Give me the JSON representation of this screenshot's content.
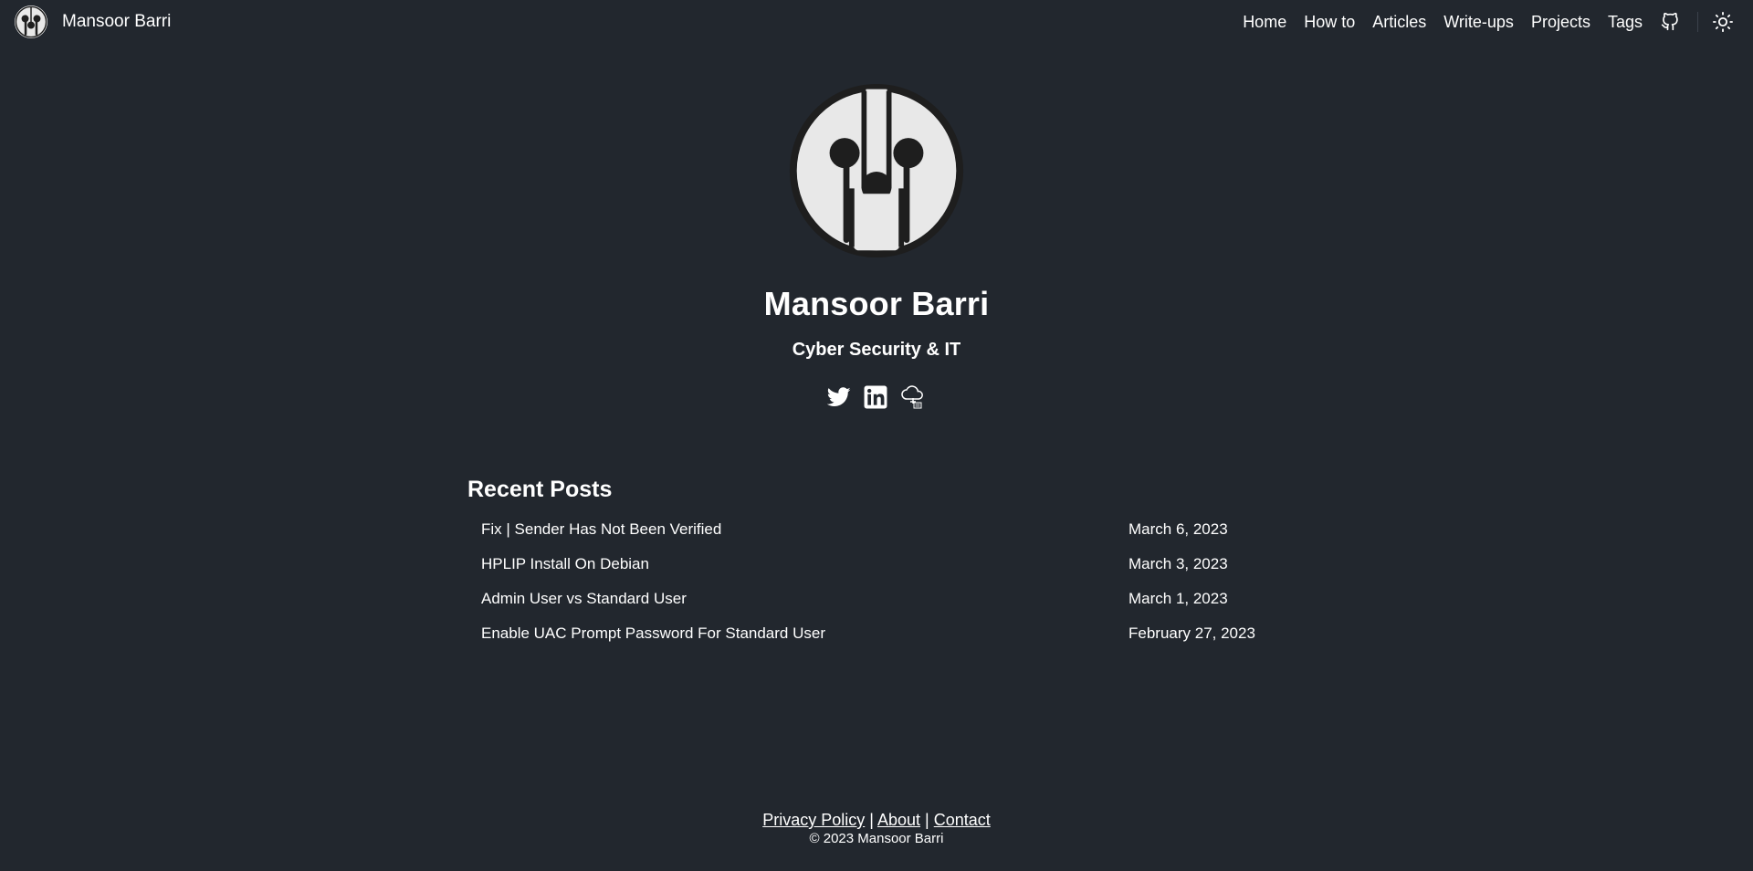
{
  "site": {
    "brand_name": "Mansoor Barri",
    "brand_logo_icon": "circuit-logo-icon"
  },
  "nav": {
    "items": [
      "Home",
      "How to",
      "Articles",
      "Write-ups",
      "Projects",
      "Tags"
    ],
    "github_icon": "github-icon",
    "theme_icon": "sun-icon"
  },
  "profile": {
    "avatar_icon": "circuit-logo-icon",
    "name": "Mansoor Barri",
    "subtitle": "Cyber Security & IT",
    "social_icons": [
      "twitter-icon",
      "linkedin-icon",
      "cloud-icon"
    ]
  },
  "recent_posts": {
    "heading": "Recent Posts",
    "posts": [
      {
        "title": "Fix | Sender Has Not Been Verified",
        "date": "March 6, 2023"
      },
      {
        "title": "HPLIP Install On Debian",
        "date": "March 3, 2023"
      },
      {
        "title": "Admin User vs Standard User",
        "date": "March 1, 2023"
      },
      {
        "title": "Enable UAC Prompt Password For Standard User",
        "date": "February 27, 2023"
      }
    ]
  },
  "footer": {
    "links": [
      "Privacy Policy",
      "About",
      "Contact"
    ],
    "separator": "|",
    "copyright": "© 2023 Mansoor Barri"
  },
  "colors": {
    "background": "#22272e",
    "text": "#ffffff",
    "logo_light": "#e8e8e8",
    "logo_dark": "#1e1e1e"
  }
}
